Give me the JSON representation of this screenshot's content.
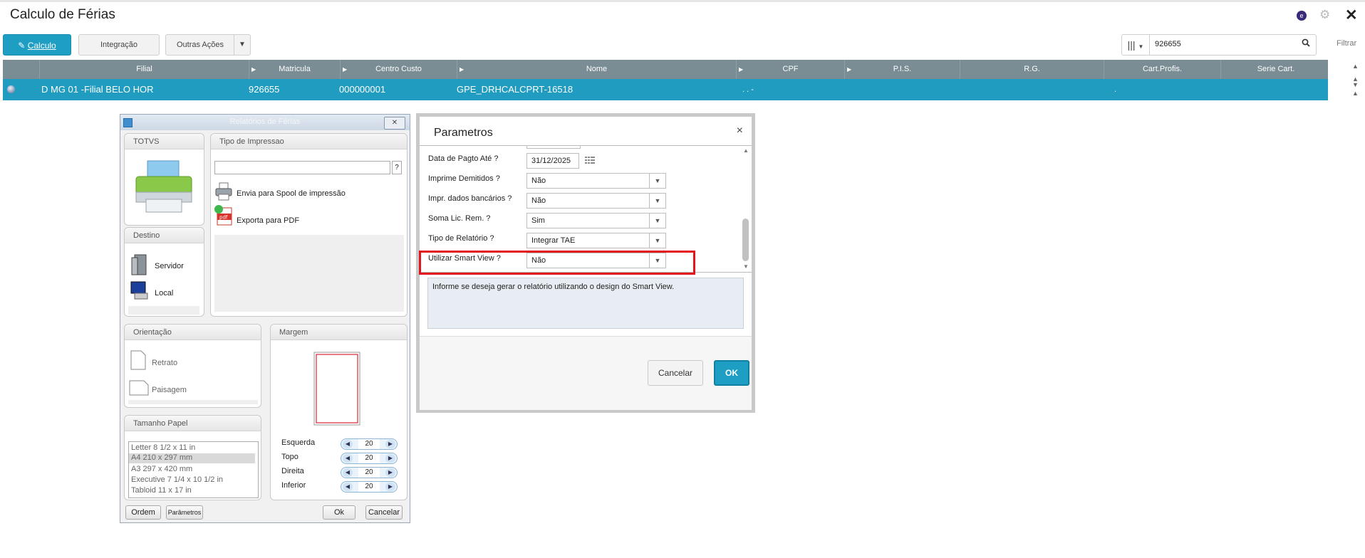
{
  "header": {
    "title": "Calculo de Férias",
    "e_badge": "e"
  },
  "toolbar": {
    "calculo": "Calculo",
    "integracao": "Integração",
    "outras": "Outras Ações",
    "search_value": "926655",
    "filtrar": "Filtrar"
  },
  "grid": {
    "columns": [
      "Filial",
      "Matricula",
      "Centro Custo",
      "Nome",
      "CPF",
      "P.I.S.",
      "R.G.",
      "Cart.Profis.",
      "Serie Cart."
    ],
    "row": {
      "filial": "D MG 01 -Filial BELO HOR",
      "matricula": "926655",
      "centro": "000000001",
      "nome": "GPE_DRHCALCPRT-16518",
      "cpf": ". . -",
      "cart": "."
    }
  },
  "relatorios": {
    "title": "Relatórios de Férias",
    "totvs": "TOTVS",
    "tipo_impressao": "Tipo de Impressao",
    "help_q": "?",
    "spool": "Envia para Spool de impressão",
    "pdf": "Exporta para PDF",
    "destino": "Destino",
    "servidor": "Servidor",
    "local": "Local",
    "orientacao": "Orientação",
    "retrato": "Retrato",
    "paisagem": "Paisagem",
    "margem": "Margem",
    "tamanho": "Tamanho Papel",
    "papers": [
      "Letter 8 1/2 x 11 in",
      "A4 210 x 297 mm",
      "A3 297 x 420 mm",
      "Executive 7 1/4 x 10 1/2 in",
      "Tabloid 11 x 17 in"
    ],
    "margins": [
      {
        "label": "Esquerda",
        "value": "20"
      },
      {
        "label": "Topo",
        "value": "20"
      },
      {
        "label": "Direita",
        "value": "20"
      },
      {
        "label": "Inferior",
        "value": "20"
      }
    ],
    "ordem": "Ordem",
    "parametros": "Parâmetros",
    "ok": "Ok",
    "cancelar": "Cancelar"
  },
  "parametros": {
    "title": "Parametros",
    "close": "×",
    "fields": [
      {
        "label": "Data de Pagto Até ?",
        "value": "31/12/2025"
      },
      {
        "label": "Imprime Demitidos ?",
        "value": "Não"
      },
      {
        "label": "Impr. dados bancários ?",
        "value": "Não"
      },
      {
        "label": "Soma Lic. Rem. ?",
        "value": "Sim"
      },
      {
        "label": "Tipo de Relatório ?",
        "value": "Integrar TAE"
      },
      {
        "label": "Utilizar Smart View ?",
        "value": "Não"
      }
    ],
    "help": "Informe se deseja gerar o relatório utilizando o design do Smart View.",
    "cancelar": "Cancelar",
    "ok": "OK"
  },
  "colors": {
    "accent": "#1f9ec4",
    "grid_header": "#7a8c94",
    "highlight": "#e3141b"
  }
}
